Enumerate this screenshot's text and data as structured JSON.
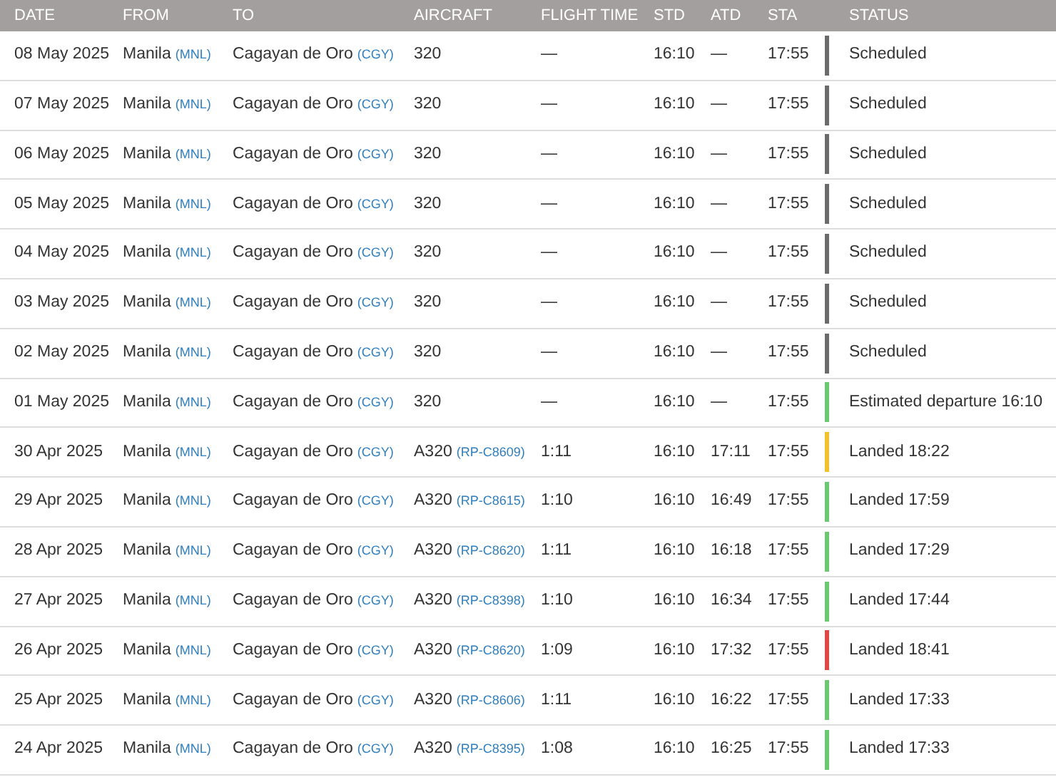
{
  "table": {
    "columns": [
      "DATE",
      "FROM",
      "TO",
      "AIRCRAFT",
      "FLIGHT TIME",
      "STD",
      "ATD",
      "STA",
      "STATUS"
    ],
    "rows": [
      {
        "date": "08 May 2025",
        "from": {
          "city": "Manila",
          "code": "(MNL)"
        },
        "to": {
          "city": "Cagayan de Oro",
          "code": "(CGY)"
        },
        "aircraft": {
          "type": "320"
        },
        "flight_time": "—",
        "std": "16:10",
        "atd": "—",
        "sta": "17:55",
        "status": "Scheduled",
        "color": "#6b6b6b"
      },
      {
        "date": "07 May 2025",
        "from": {
          "city": "Manila",
          "code": "(MNL)"
        },
        "to": {
          "city": "Cagayan de Oro",
          "code": "(CGY)"
        },
        "aircraft": {
          "type": "320"
        },
        "flight_time": "—",
        "std": "16:10",
        "atd": "—",
        "sta": "17:55",
        "status": "Scheduled",
        "color": "#6b6b6b"
      },
      {
        "date": "06 May 2025",
        "from": {
          "city": "Manila",
          "code": "(MNL)"
        },
        "to": {
          "city": "Cagayan de Oro",
          "code": "(CGY)"
        },
        "aircraft": {
          "type": "320"
        },
        "flight_time": "—",
        "std": "16:10",
        "atd": "—",
        "sta": "17:55",
        "status": "Scheduled",
        "color": "#6b6b6b"
      },
      {
        "date": "05 May 2025",
        "from": {
          "city": "Manila",
          "code": "(MNL)"
        },
        "to": {
          "city": "Cagayan de Oro",
          "code": "(CGY)"
        },
        "aircraft": {
          "type": "320"
        },
        "flight_time": "—",
        "std": "16:10",
        "atd": "—",
        "sta": "17:55",
        "status": "Scheduled",
        "color": "#6b6b6b"
      },
      {
        "date": "04 May 2025",
        "from": {
          "city": "Manila",
          "code": "(MNL)"
        },
        "to": {
          "city": "Cagayan de Oro",
          "code": "(CGY)"
        },
        "aircraft": {
          "type": "320"
        },
        "flight_time": "—",
        "std": "16:10",
        "atd": "—",
        "sta": "17:55",
        "status": "Scheduled",
        "color": "#6b6b6b"
      },
      {
        "date": "03 May 2025",
        "from": {
          "city": "Manila",
          "code": "(MNL)"
        },
        "to": {
          "city": "Cagayan de Oro",
          "code": "(CGY)"
        },
        "aircraft": {
          "type": "320"
        },
        "flight_time": "—",
        "std": "16:10",
        "atd": "—",
        "sta": "17:55",
        "status": "Scheduled",
        "color": "#6b6b6b"
      },
      {
        "date": "02 May 2025",
        "from": {
          "city": "Manila",
          "code": "(MNL)"
        },
        "to": {
          "city": "Cagayan de Oro",
          "code": "(CGY)"
        },
        "aircraft": {
          "type": "320"
        },
        "flight_time": "—",
        "std": "16:10",
        "atd": "—",
        "sta": "17:55",
        "status": "Scheduled",
        "color": "#6b6b6b"
      },
      {
        "date": "01 May 2025",
        "from": {
          "city": "Manila",
          "code": "(MNL)"
        },
        "to": {
          "city": "Cagayan de Oro",
          "code": "(CGY)"
        },
        "aircraft": {
          "type": "320"
        },
        "flight_time": "—",
        "std": "16:10",
        "atd": "—",
        "sta": "17:55",
        "status": "Estimated departure 16:10",
        "color": "#6cc871"
      },
      {
        "date": "30 Apr 2025",
        "from": {
          "city": "Manila",
          "code": "(MNL)"
        },
        "to": {
          "city": "Cagayan de Oro",
          "code": "(CGY)"
        },
        "aircraft": {
          "type": "A320",
          "registration": "(RP-C8609)"
        },
        "flight_time": "1:11",
        "std": "16:10",
        "atd": "17:11",
        "sta": "17:55",
        "status": "Landed 18:22",
        "color": "#f2c12e"
      },
      {
        "date": "29 Apr 2025",
        "from": {
          "city": "Manila",
          "code": "(MNL)"
        },
        "to": {
          "city": "Cagayan de Oro",
          "code": "(CGY)"
        },
        "aircraft": {
          "type": "A320",
          "registration": "(RP-C8615)"
        },
        "flight_time": "1:10",
        "std": "16:10",
        "atd": "16:49",
        "sta": "17:55",
        "status": "Landed 17:59",
        "color": "#6cc871"
      },
      {
        "date": "28 Apr 2025",
        "from": {
          "city": "Manila",
          "code": "(MNL)"
        },
        "to": {
          "city": "Cagayan de Oro",
          "code": "(CGY)"
        },
        "aircraft": {
          "type": "A320",
          "registration": "(RP-C8620)"
        },
        "flight_time": "1:11",
        "std": "16:10",
        "atd": "16:18",
        "sta": "17:55",
        "status": "Landed 17:29",
        "color": "#6cc871"
      },
      {
        "date": "27 Apr 2025",
        "from": {
          "city": "Manila",
          "code": "(MNL)"
        },
        "to": {
          "city": "Cagayan de Oro",
          "code": "(CGY)"
        },
        "aircraft": {
          "type": "A320",
          "registration": "(RP-C8398)"
        },
        "flight_time": "1:10",
        "std": "16:10",
        "atd": "16:34",
        "sta": "17:55",
        "status": "Landed 17:44",
        "color": "#6cc871"
      },
      {
        "date": "26 Apr 2025",
        "from": {
          "city": "Manila",
          "code": "(MNL)"
        },
        "to": {
          "city": "Cagayan de Oro",
          "code": "(CGY)"
        },
        "aircraft": {
          "type": "A320",
          "registration": "(RP-C8620)"
        },
        "flight_time": "1:09",
        "std": "16:10",
        "atd": "17:32",
        "sta": "17:55",
        "status": "Landed 18:41",
        "color": "#e04848"
      },
      {
        "date": "25 Apr 2025",
        "from": {
          "city": "Manila",
          "code": "(MNL)"
        },
        "to": {
          "city": "Cagayan de Oro",
          "code": "(CGY)"
        },
        "aircraft": {
          "type": "A320",
          "registration": "(RP-C8606)"
        },
        "flight_time": "1:11",
        "std": "16:10",
        "atd": "16:22",
        "sta": "17:55",
        "status": "Landed 17:33",
        "color": "#6cc871"
      },
      {
        "date": "24 Apr 2025",
        "from": {
          "city": "Manila",
          "code": "(MNL)"
        },
        "to": {
          "city": "Cagayan de Oro",
          "code": "(CGY)"
        },
        "aircraft": {
          "type": "A320",
          "registration": "(RP-C8395)"
        },
        "flight_time": "1:08",
        "std": "16:10",
        "atd": "16:25",
        "sta": "17:55",
        "status": "Landed 17:33",
        "color": "#6cc871"
      }
    ]
  }
}
